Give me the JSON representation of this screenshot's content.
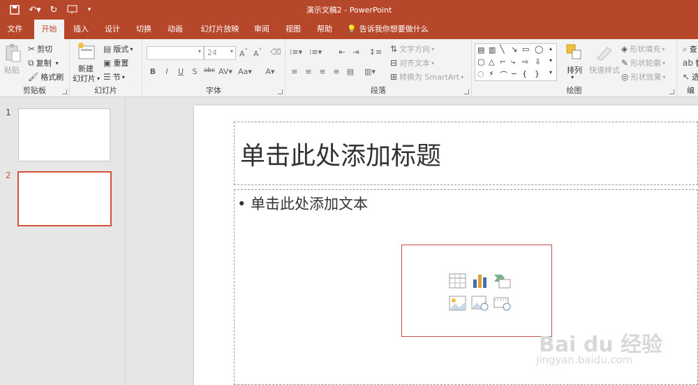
{
  "window": {
    "title": "演示文稿2  -  PowerPoint"
  },
  "tabs": [
    "文件",
    "开始",
    "插入",
    "设计",
    "切换",
    "动画",
    "幻灯片放映",
    "审阅",
    "视图",
    "帮助"
  ],
  "tell_me": "告诉我你想要做什么",
  "clipboard": {
    "paste": "粘贴",
    "cut": "剪切",
    "copy": "复制",
    "format_painter": "格式刷",
    "group": "剪贴板"
  },
  "slides_group": {
    "new_slide_1": "新建",
    "new_slide_2": "幻灯片",
    "layout": "版式",
    "reset": "重置",
    "section": "节",
    "group": "幻灯片"
  },
  "font": {
    "font_size": "24",
    "group": "字体"
  },
  "paragraph": {
    "text_direction": "文字方向",
    "align_text": "对齐文本",
    "smartart": "转换为 SmartArt",
    "group": "段落"
  },
  "drawing": {
    "arrange": "排列",
    "quick_styles": "快速样式",
    "shape_fill": "形状填充",
    "shape_outline": "形状轮廓",
    "shape_effects": "形状效果",
    "group": "绘图"
  },
  "editing": {
    "find": "查",
    "replace": "替",
    "select": "选",
    "group": "编"
  },
  "thumbnails": [
    "1",
    "2"
  ],
  "slide": {
    "title": "单击此处添加标题",
    "body": "• 单击此处添加文本"
  },
  "watermark": {
    "brand": "Bai du 经验",
    "url": "jingyan.baidu.com"
  },
  "colors": {
    "accent": "#b7472a",
    "selected_thumb": "#d0533a"
  }
}
